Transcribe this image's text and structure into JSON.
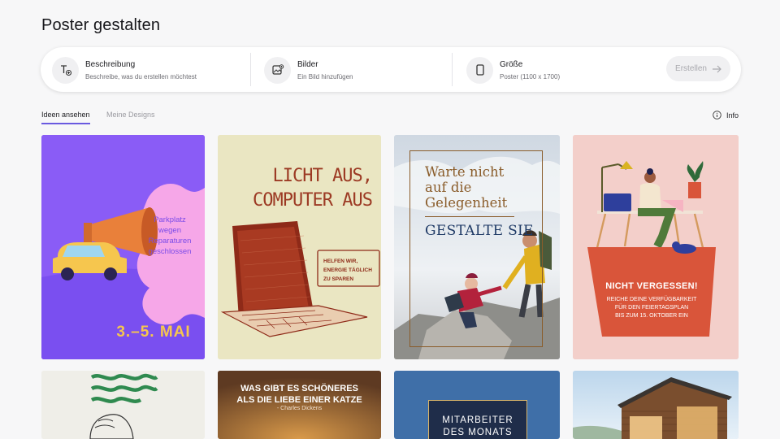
{
  "page": {
    "title": "Poster gestalten"
  },
  "prompt_bar": {
    "description": {
      "label": "Beschreibung",
      "sub": "Beschreibe, was du erstellen möchtest",
      "icon": "text-add-icon"
    },
    "images": {
      "label": "Bilder",
      "sub": "Ein Bild hinzufügen",
      "icon": "image-add-icon"
    },
    "size": {
      "label": "Größe",
      "sub": "Poster (1100 x 1700)",
      "icon": "portrait-page-icon"
    },
    "create_label": "Erstellen"
  },
  "tabs": [
    {
      "label": "Ideen ansehen",
      "active": true
    },
    {
      "label": "Meine Designs",
      "active": false
    }
  ],
  "info_label": "Info",
  "templates": {
    "parking": {
      "text": [
        "Parkplatz",
        "wegen",
        "Reparaturen",
        "geschlossen"
      ],
      "date": "3.–5. MAI"
    },
    "lights": {
      "line1": "LICHT AUS,",
      "line2": "COMPUTER AUS",
      "box": [
        "HELFEN WIR,",
        "ENERGIE TÄGLICH",
        "ZU SPAREN"
      ]
    },
    "chance": {
      "lines": [
        "Warte nicht",
        "auf die",
        "Gelegenheit"
      ],
      "cta": "GESTALTE SIE"
    },
    "reminder": {
      "title": "NICHT VERGESSEN!",
      "body": [
        "REICHE DEINE VERFÜGBARKEIT",
        "FÜR DEN FEIERTAGSPLAN",
        "BIS ZUM 15. OKTOBER EIN"
      ]
    },
    "cat": {
      "lines": [
        "WAS GIBT ES SCHÖNERES",
        "ALS DIE LIEBE EINER KATZE"
      ],
      "author": "- Charles Dickens"
    },
    "employee": {
      "lines": [
        "MITARBEITER",
        "DES MONATS"
      ]
    }
  },
  "colors": {
    "accent": "#6a5ae0",
    "purple": "#8a5cf6",
    "pink_bg": "#f3cfca",
    "orange": "#d9553a",
    "navy": "#1f2d4a"
  }
}
